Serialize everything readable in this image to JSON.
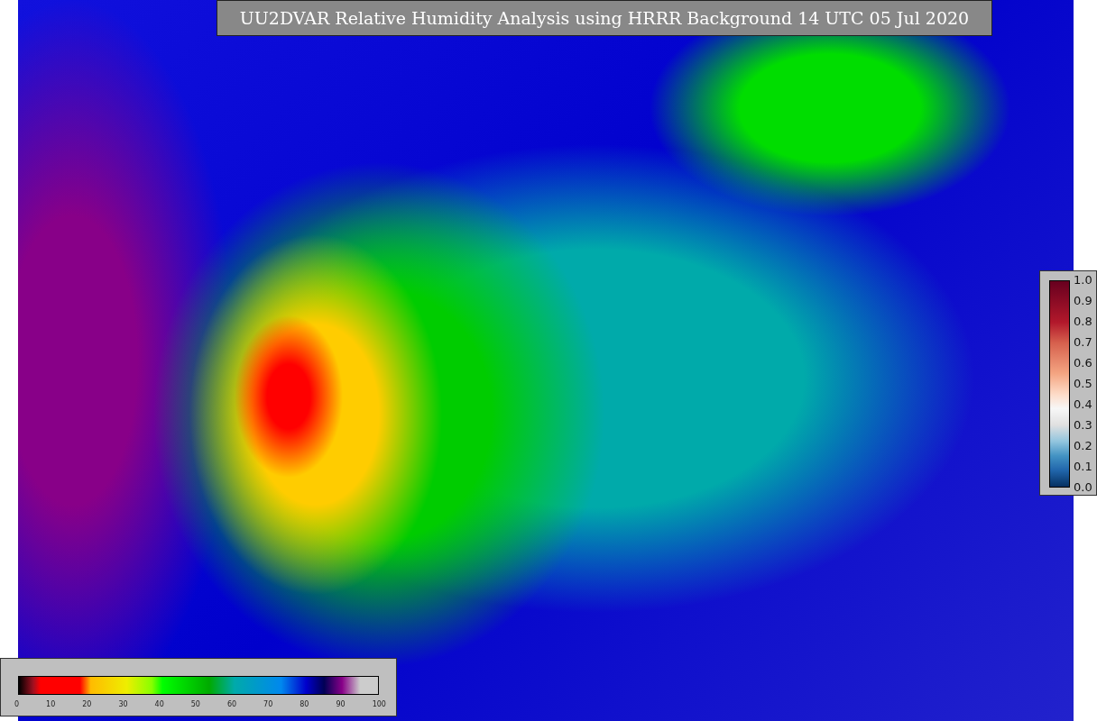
{
  "title": "UU2DVAR Relative Humidity Analysis using HRRR Background 14 UTC 05 Jul 2020",
  "humidity_scale": {
    "ticks": [
      "0",
      "10",
      "20",
      "30",
      "40",
      "50",
      "60",
      "70",
      "80",
      "90",
      "100"
    ]
  },
  "ratio_scale": {
    "ticks": [
      "1.0",
      "0.9",
      "0.8",
      "0.7",
      "0.6",
      "0.5",
      "0.4",
      "0.3",
      "0.2",
      "0.1",
      "0.0"
    ]
  }
}
